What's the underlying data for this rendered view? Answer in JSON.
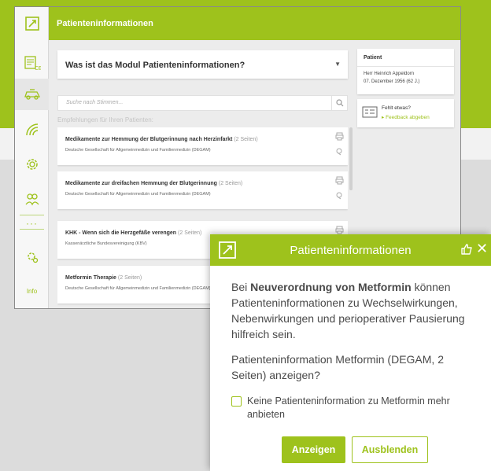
{
  "app": {
    "header_title": "Patienteninformationen",
    "module_question": "Was ist das Modul Patienteninformationen?",
    "search_placeholder": "Suche nach Stimmen...",
    "recommendations_heading": "Empfehlungen für Ihren Patienten:",
    "sidebar": {
      "icons": [
        "app-logo-icon",
        "ce-document-icon",
        "car-icon",
        "signal-icon",
        "gear-check-icon",
        "people-icon",
        "settings-icon"
      ],
      "more": "···",
      "info_label": "Info"
    },
    "documents": [
      {
        "title": "Medikamente zur Hemmung der Blutgerinnung nach Herzinfarkt",
        "pages": "(2 Seiten)",
        "source": "Deutsche Gesellschaft für Allgemeinmedizin und Familienmedizin (DEGAM)"
      },
      {
        "title": "Medikamente zur dreifachen Hemmung der Blutgerinnung",
        "pages": "(2 Seiten)",
        "source": "Deutsche Gesellschaft für Allgemeinmedizin und Familienmedizin (DEGAM)"
      },
      {
        "title": "KHK - Wenn sich die Herzgefäße verengen",
        "pages": "(2 Seiten)",
        "source": "Kassenärztliche Bundesvereinigung (KBV)"
      },
      {
        "title": "Metformin Therapie",
        "pages": "(2 Seiten)",
        "source": "Deutsche Gesellschaft für Allgemeinmedizin und Familienmedizin (DEGAM)"
      }
    ],
    "patient": {
      "heading": "Patient",
      "name": "Herr Heinrich Appeldorn",
      "dob": "07. Dezember 1956 (62 J.)"
    },
    "feedback": {
      "question": "Fehlt etwas?",
      "link": "▸ Feedback abgeben"
    }
  },
  "popup": {
    "title": "Patienteninformationen",
    "body_pre": "Bei ",
    "body_bold": "Neuverordnung von Metformin",
    "body_post": " können Patienteninformationen zu Wechselwirkungen, Nebenwirkungen und perioperativer Pausierung hilfreich sein.",
    "question": "Patienteninformation Metformin (DEGAM, 2 Seiten) anzeigen?",
    "checkbox_label": "Keine Patienteninformation zu Metformin mehr anbieten",
    "checkbox_checked": false,
    "show_button": "Anzeigen",
    "hide_button": "Ausblenden"
  },
  "colors": {
    "brand_green": "#9ec21c",
    "background_gray": "#dcdcdc"
  }
}
